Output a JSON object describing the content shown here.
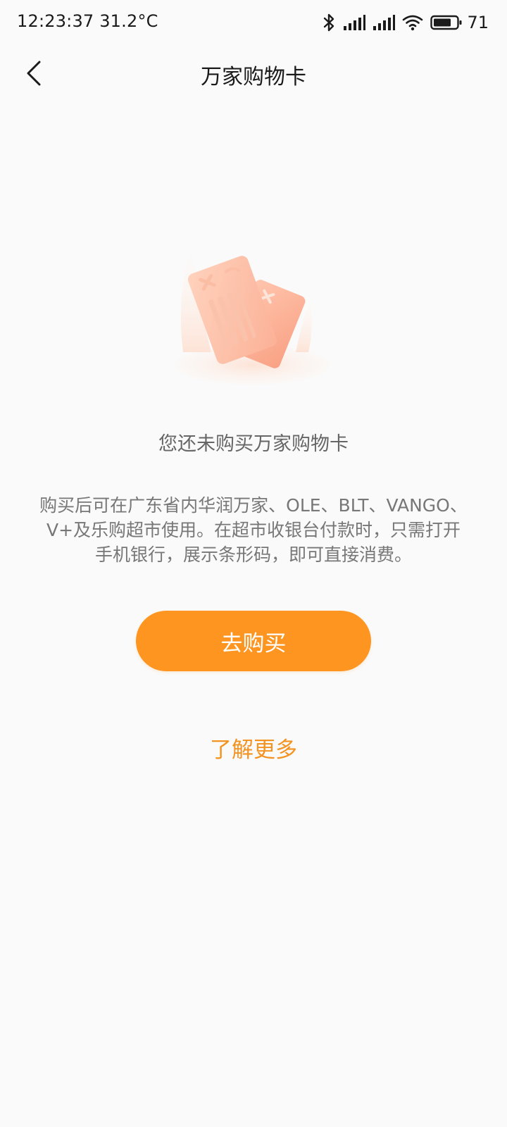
{
  "status_bar": {
    "time_temp": "12:23:37 31.2°C",
    "battery": "71"
  },
  "header": {
    "title": "万家购物卡"
  },
  "empty_state": {
    "title": "您还未购买万家购物卡",
    "description_lines": [
      "购买后可在广东省内华润万家、OLE、BLT、VANGO、",
      "V+及乐购超市使用。在超市收银台付款时，只需打开",
      "手机银行，展示条形码，即可直接消费。"
    ]
  },
  "actions": {
    "buy_label": "去购买",
    "learn_more_label": "了解更多"
  },
  "icons": {
    "back": "chevron-left-icon",
    "bluetooth": "bluetooth-icon",
    "signal": "signal-icon",
    "wifi": "wifi-icon",
    "battery": "battery-icon",
    "illustration": "shopping-cards-illustration"
  },
  "colors": {
    "accent": "#fd9520",
    "link": "#f39321",
    "background": "#fafafa"
  }
}
